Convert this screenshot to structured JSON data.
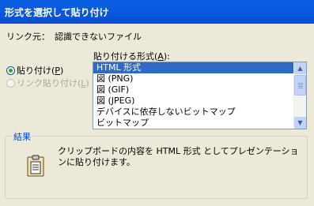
{
  "window": {
    "title": "形式を選択して貼り付け"
  },
  "link_source": {
    "label": "リンク元：",
    "value": "認識できないファイル"
  },
  "options": {
    "paste": {
      "label": "貼り付け(",
      "mnemonic": "P",
      "suffix": ")",
      "checked": true
    },
    "paste_link": {
      "label": "リンク貼り付け(",
      "mnemonic": "L",
      "suffix": ")",
      "disabled": true
    }
  },
  "format_list": {
    "label": "貼り付ける形式(",
    "mnemonic": "A",
    "suffix": "):",
    "items": [
      "HTML 形式",
      "図 (PNG)",
      "図 (GIF)",
      "図 (JPEG)",
      "デバイスに依存しないビットマップ",
      "ビットマップ"
    ],
    "selected_index": 0
  },
  "result": {
    "title": "結果",
    "text": "クリップボードの内容を HTML 形式 としてプレゼンテーションに貼り付けます。",
    "icon": "clipboard-icon"
  },
  "colors": {
    "titlebar": "#0a5ae0",
    "selection": "#316ac5",
    "group_title": "#0046d5"
  }
}
